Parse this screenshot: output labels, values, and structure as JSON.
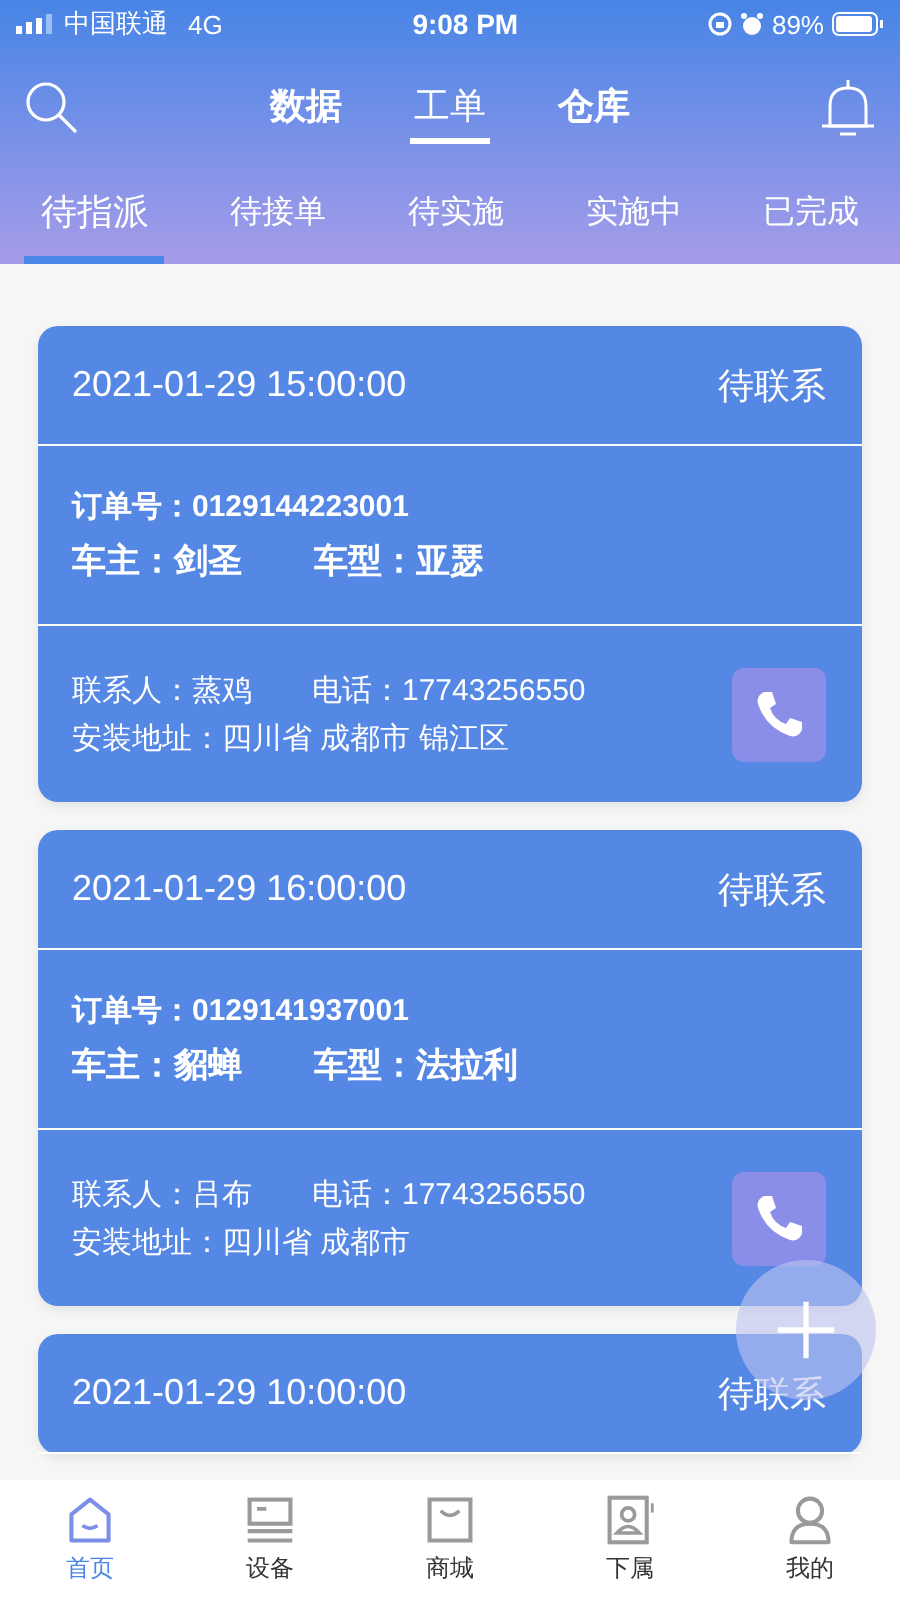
{
  "status_bar": {
    "carrier": "中国联通",
    "network": "4G",
    "time": "9:08 PM",
    "battery": "89%"
  },
  "top_tabs": [
    {
      "label": "数据",
      "selected": false
    },
    {
      "label": "工单",
      "selected": true
    },
    {
      "label": "仓库",
      "selected": false
    }
  ],
  "sub_tabs": [
    {
      "label": "待指派",
      "selected": true
    },
    {
      "label": "待接单",
      "selected": false
    },
    {
      "label": "待实施",
      "selected": false
    },
    {
      "label": "实施中",
      "selected": false
    },
    {
      "label": "已完成",
      "selected": false
    }
  ],
  "orders": [
    {
      "time": "2021-01-29 15:00:00",
      "status": "待联系",
      "order_no": "订单号：0129144223001",
      "owner": "车主：剑圣",
      "model": "车型：亚瑟",
      "contact": "联系人：蒸鸡",
      "phone": "电话：17743256550",
      "address": "安装地址：四川省 成都市 锦江区"
    },
    {
      "time": "2021-01-29 16:00:00",
      "status": "待联系",
      "order_no": "订单号：0129141937001",
      "owner": "车主：貂蝉",
      "model": "车型：法拉利",
      "contact": "联系人：吕布",
      "phone": "电话：17743256550",
      "address": "安装地址：四川省 成都市"
    },
    {
      "time": "2021-01-29 10:00:00",
      "status": "待联系"
    }
  ],
  "bottom_nav": [
    {
      "label": "首页",
      "selected": true,
      "kind": "home"
    },
    {
      "label": "设备",
      "selected": false,
      "kind": "device"
    },
    {
      "label": "商城",
      "selected": false,
      "kind": "shop"
    },
    {
      "label": "下属",
      "selected": false,
      "kind": "contacts"
    },
    {
      "label": "我的",
      "selected": false,
      "kind": "profile"
    }
  ]
}
